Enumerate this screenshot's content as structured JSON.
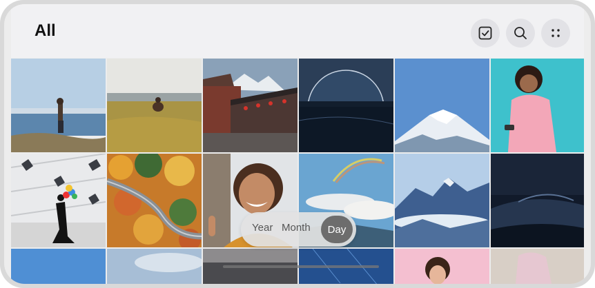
{
  "header": {
    "title": "All"
  },
  "view_switcher": {
    "options": [
      "Year",
      "Month",
      "Day"
    ],
    "selected": "Day"
  },
  "toolbar": {
    "icons": [
      "select-icon",
      "search-icon",
      "more-icon"
    ]
  },
  "photos": [
    "woman-by-sea",
    "person-in-field",
    "chinese-temple-mountain",
    "lake-moon-night",
    "snow-mountain",
    "woman-pink-sweater",
    "woman-balloons",
    "autumn-forest-road",
    "smiling-woman-selfie",
    "rainbow-sky",
    "blue-mountains",
    "dark-landscape",
    "blue-sky",
    "cloudy-sky",
    "dark-partial",
    "night-sky",
    "girl-pink",
    "woman-pink-dress"
  ]
}
